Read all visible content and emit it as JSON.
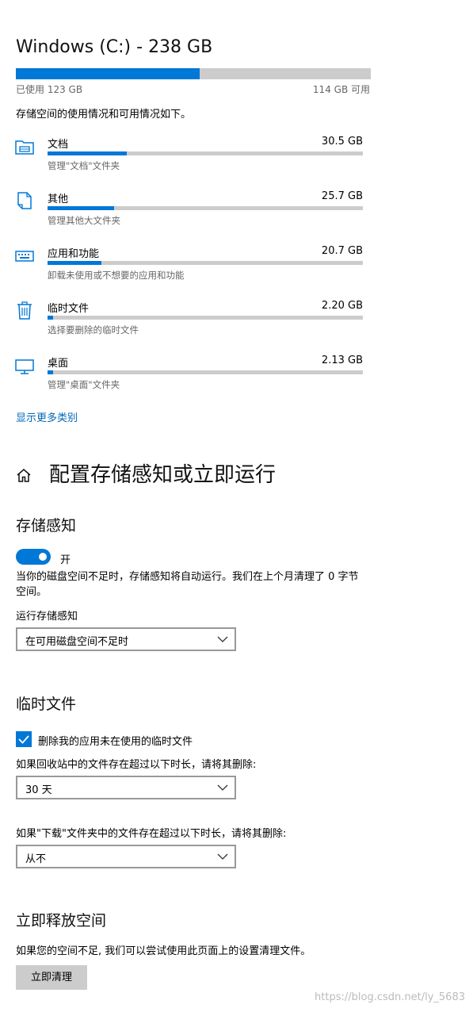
{
  "disk": {
    "title": "Windows (C:) - 238 GB",
    "used_fraction": 0.517,
    "used_label": "已使用 123 GB",
    "free_label": "114 GB 可用",
    "description": "存储空间的使用情况和可用情况如下。"
  },
  "categories": [
    {
      "name": "文档",
      "size": "30.5 GB",
      "desc": "管理\"文档\"文件夹",
      "fraction": 0.25,
      "icon": "documents-folder-icon"
    },
    {
      "name": "其他",
      "size": "25.7 GB",
      "desc": "管理其他大文件夹",
      "fraction": 0.21,
      "icon": "other-files-icon"
    },
    {
      "name": "应用和功能",
      "size": "20.7 GB",
      "desc": "卸载未使用或不想要的应用和功能",
      "fraction": 0.17,
      "icon": "keyboard-icon"
    },
    {
      "name": "临时文件",
      "size": "2.20 GB",
      "desc": "选择要删除的临时文件",
      "fraction": 0.018,
      "icon": "trash-icon"
    },
    {
      "name": "桌面",
      "size": "2.13 GB",
      "desc": "管理\"桌面\"文件夹",
      "fraction": 0.017,
      "icon": "monitor-icon"
    }
  ],
  "show_more_link": "显示更多类别",
  "page": {
    "title": "配置存储感知或立即运行",
    "home_icon": "home-icon"
  },
  "storage_sense": {
    "heading": "存储感知",
    "toggle_state": "on",
    "toggle_label": "开",
    "description": "当你的磁盘空间不足时，存储感知将自动运行。我们在上个月清理了 0 字节 空间。",
    "run_label": "运行存储感知",
    "run_value": "在可用磁盘空间不足时"
  },
  "temp_files": {
    "heading": "临时文件",
    "checkbox_checked": true,
    "checkbox_label": "删除我的应用未在使用的临时文件",
    "recycle_label": "如果回收站中的文件存在超过以下时长，请将其删除:",
    "recycle_value": "30 天",
    "downloads_label": "如果\"下载\"文件夹中的文件存在超过以下时长，请将其删除:",
    "downloads_value": "从不"
  },
  "free_now": {
    "heading": "立即释放空间",
    "description": "如果您的空间不足, 我们可以尝试使用此页面上的设置清理文件。",
    "button_label": "立即清理"
  },
  "watermark": "https://blog.csdn.net/ly_5683",
  "colors": {
    "accent": "#0078d7",
    "bar_background": "#cccccc",
    "link": "#0067b8"
  }
}
